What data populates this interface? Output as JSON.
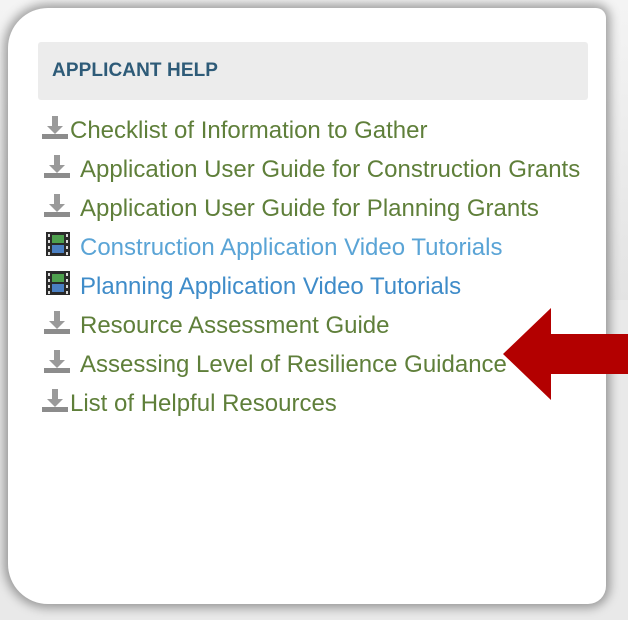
{
  "panel": {
    "title": "APPLICANT HELP"
  },
  "links": [
    {
      "label": "Checklist of Information to Gather",
      "icon": "download-icon",
      "color": "#5f7f3a"
    },
    {
      "label": "Application User Guide for Construction Grants",
      "icon": "download-icon",
      "color": "#5f7f3a"
    },
    {
      "label": "Application User Guide for Planning Grants",
      "icon": "download-icon",
      "color": "#5f7f3a"
    },
    {
      "label": "Construction Application Video Tutorials",
      "icon": "film-icon",
      "color": "#5aa4d6"
    },
    {
      "label": "Planning Application Video Tutorials",
      "icon": "film-icon",
      "color": "#3f8cc9"
    },
    {
      "label": "Resource Assessment Guide",
      "icon": "download-icon",
      "color": "#5f7f3a"
    },
    {
      "label": "Assessing Level of Resilience Guidance",
      "icon": "download-icon",
      "color": "#5f7f3a"
    },
    {
      "label": "List of Helpful Resources",
      "icon": "download-icon",
      "color": "#5f7f3a"
    }
  ],
  "annotation": {
    "arrow_color": "#b30000"
  }
}
